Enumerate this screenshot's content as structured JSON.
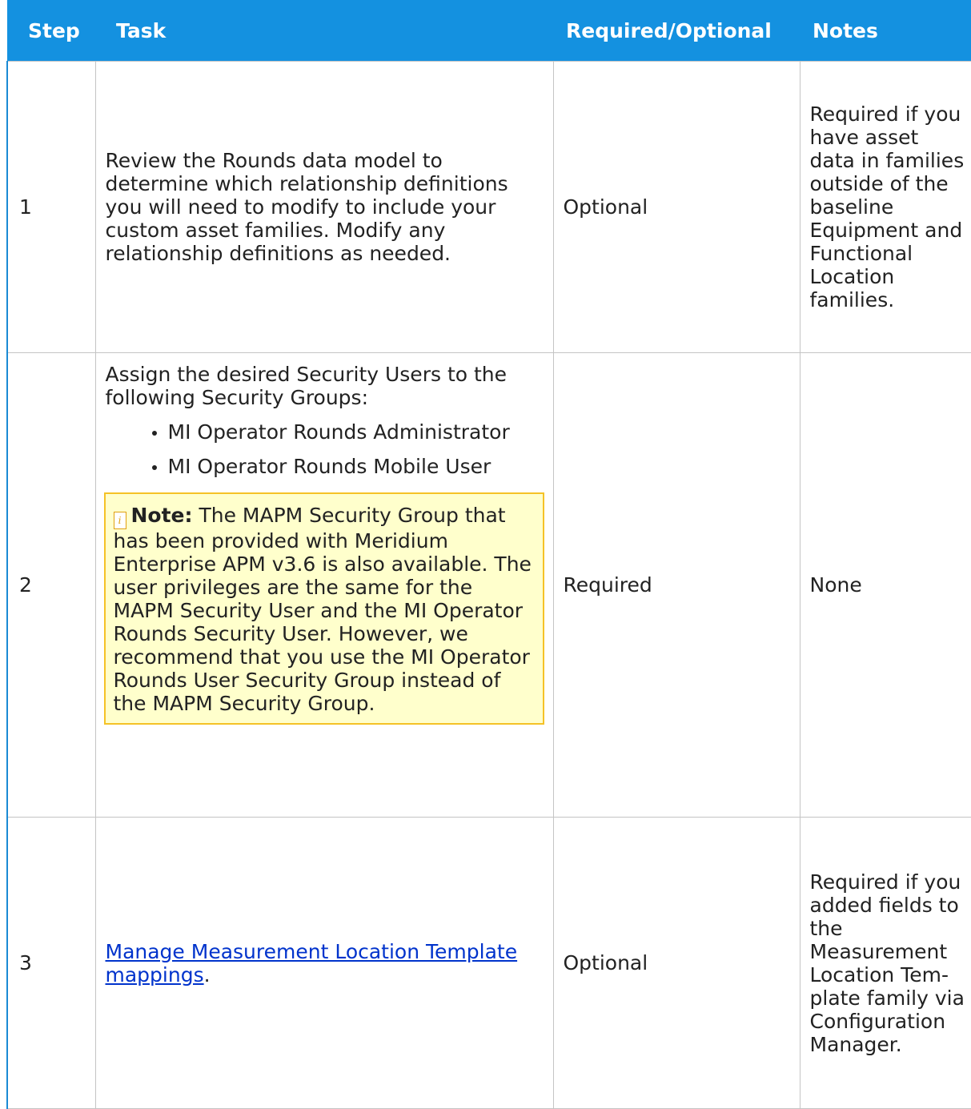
{
  "table": {
    "headers": {
      "step": "Step",
      "task": "Task",
      "required": "Required/Optional",
      "notes": "Notes"
    },
    "rows": [
      {
        "step": "1",
        "task": "Review the Rounds data model to determine which relationship def­in­itions you will need to modify to include your custom asset families. Modify any relationship definitions as needed.",
        "required": "Optional",
        "notes": "Required if you have asset data in families out­side of the baseline Equipment and Func­tional Loca­tion families."
      },
      {
        "step": "2",
        "task_intro": "Assign the desired Security Users to the following Security Groups:",
        "groups": [
          "MI Operator Rounds Administrator",
          "MI Operator Rounds Mobile User"
        ],
        "note_label": "Note:",
        "note_text": " The MAPM Security Group that has been provided with Meridium Enterprise APM v3.6 is also available. The user privileges are the same for the MAPM Security User and the MI Operator Rounds Security User. However, we recommend that you use the MI Operator Rounds User Security Group instead of the MAPM Security Group.",
        "required": "Required",
        "notes": "None"
      },
      {
        "step": "3",
        "task_link": "Manage Measurement Location Tem­plate mappings",
        "task_suffix": ".",
        "required": "Optional",
        "notes": "Required if you added fields to the Measurement Location Tem­plate family via Con­figuration Manager."
      }
    ]
  },
  "colors": {
    "header_bg": "#1491e0",
    "note_bg": "#ffffcc",
    "note_border": "#f5c227",
    "link": "#0033cc"
  }
}
